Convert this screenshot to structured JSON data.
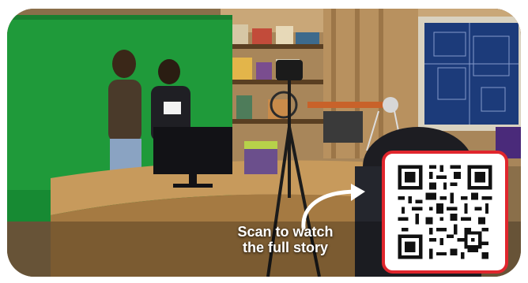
{
  "caption": {
    "line1": "Scan to watch",
    "line2": "the full story"
  },
  "colors": {
    "qr_border": "#e0262d",
    "caption_text": "#ffffff",
    "green_screen": "#1f9a3a"
  },
  "icons": {
    "arrow": "curved-arrow-icon",
    "qr": "qr-code-icon"
  }
}
